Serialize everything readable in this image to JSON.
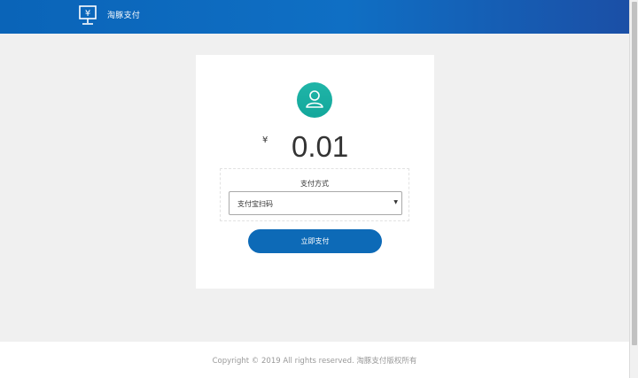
{
  "header": {
    "brand": "淘豚支付",
    "logo_icon": "yen-monitor-icon"
  },
  "payment": {
    "avatar_icon": "user-icon",
    "currency_symbol": "¥",
    "amount": "0.01",
    "method_label": "支付方式",
    "method_selected": "支付宝扫码",
    "select_arrow": "▼",
    "pay_button": "立即支付"
  },
  "footer": {
    "copyright": "Copyright © 2019 All rights reserved. 淘豚支付版权所有"
  },
  "colors": {
    "header_blue": "#0f6fc4",
    "avatar_teal": "#13a79b",
    "button_blue": "#0d6ab7"
  }
}
